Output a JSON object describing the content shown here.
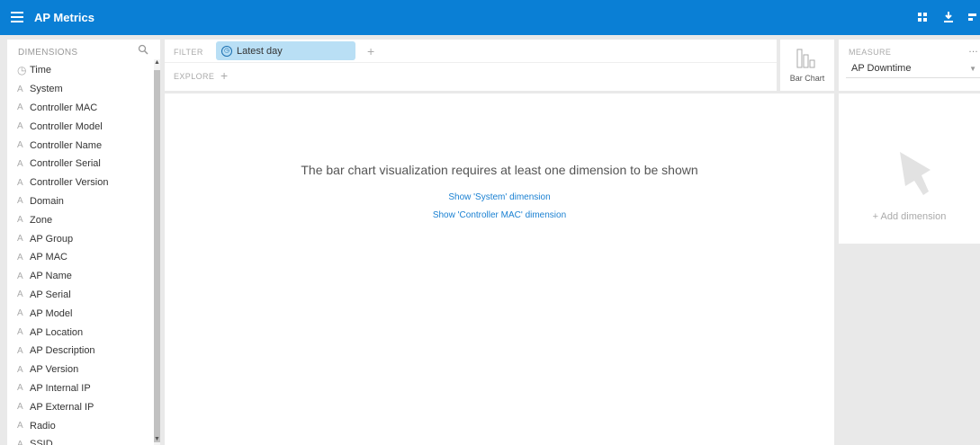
{
  "app": {
    "title": "AP Metrics"
  },
  "toolbar": {
    "icons": [
      "grid-icon",
      "download-icon",
      "settings-icon"
    ]
  },
  "dimensions": {
    "header": "DIMENSIONS",
    "items": [
      {
        "label": "Time",
        "icon": "clock-icon"
      },
      {
        "label": "System",
        "icon": "string-icon"
      },
      {
        "label": "Controller MAC",
        "icon": "string-icon"
      },
      {
        "label": "Controller Model",
        "icon": "string-icon"
      },
      {
        "label": "Controller Name",
        "icon": "string-icon"
      },
      {
        "label": "Controller Serial",
        "icon": "string-icon"
      },
      {
        "label": "Controller Version",
        "icon": "string-icon"
      },
      {
        "label": "Domain",
        "icon": "string-icon"
      },
      {
        "label": "Zone",
        "icon": "string-icon"
      },
      {
        "label": "AP Group",
        "icon": "string-icon"
      },
      {
        "label": "AP MAC",
        "icon": "string-icon"
      },
      {
        "label": "AP Name",
        "icon": "string-icon"
      },
      {
        "label": "AP Serial",
        "icon": "string-icon"
      },
      {
        "label": "AP Model",
        "icon": "string-icon"
      },
      {
        "label": "AP Location",
        "icon": "string-icon"
      },
      {
        "label": "AP Description",
        "icon": "string-icon"
      },
      {
        "label": "AP Version",
        "icon": "string-icon"
      },
      {
        "label": "AP Internal IP",
        "icon": "string-icon"
      },
      {
        "label": "AP External IP",
        "icon": "string-icon"
      },
      {
        "label": "Radio",
        "icon": "string-icon"
      },
      {
        "label": "SSID",
        "icon": "string-icon"
      }
    ]
  },
  "filter": {
    "label": "FILTER",
    "pill": "Latest day",
    "add": "+"
  },
  "explore": {
    "label": "EXPLORE",
    "add": "+"
  },
  "visualization": {
    "label": "Bar Chart"
  },
  "measure": {
    "label": "MEASURE",
    "more": "…",
    "value": "AP Downtime"
  },
  "main": {
    "message": "The bar chart visualization requires at least one dimension to be shown",
    "link1": "Show 'System' dimension",
    "link2": "Show 'Controller MAC' dimension"
  },
  "pinboard": {
    "add_label": "+  Add dimension"
  },
  "colors": {
    "accent": "#0a7fd5",
    "pill": "#b9dff5",
    "link": "#1a80d2"
  }
}
